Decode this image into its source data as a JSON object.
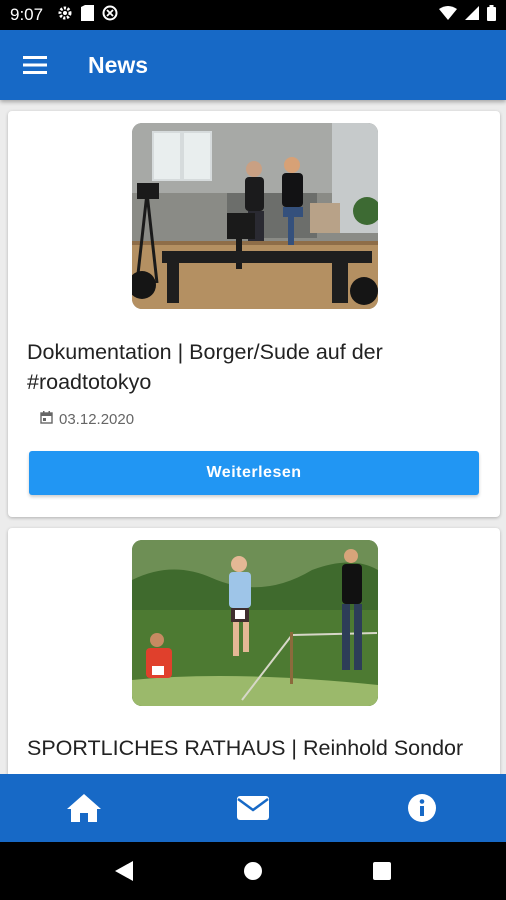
{
  "status_bar": {
    "time": "9:07",
    "left_icons": [
      "gear-icon",
      "sim-card-icon",
      "data-saver-icon"
    ],
    "right_icons": [
      "wifi-icon",
      "signal-icon",
      "battery-icon"
    ]
  },
  "app_bar": {
    "menu_icon": "hamburger-menu-icon",
    "title": "News",
    "color": "#1769c6"
  },
  "news": [
    {
      "image": "interview-film-set-photo",
      "title": "Dokumentation | Borger/Sude auf der #roadtotokyo",
      "date": "03.12.2020",
      "button_label": "Weiterlesen"
    },
    {
      "image": "trail-runners-photo",
      "title": "SPORTLICHES RATHAUS | Reinhold Sondor"
    }
  ],
  "bottom_nav": {
    "items": [
      "home-icon",
      "mail-icon",
      "info-icon"
    ]
  },
  "system_nav": {
    "items": [
      "back-icon",
      "home-circle-icon",
      "recents-icon"
    ]
  },
  "colors": {
    "accent": "#2196f3",
    "primary": "#1769c6"
  }
}
